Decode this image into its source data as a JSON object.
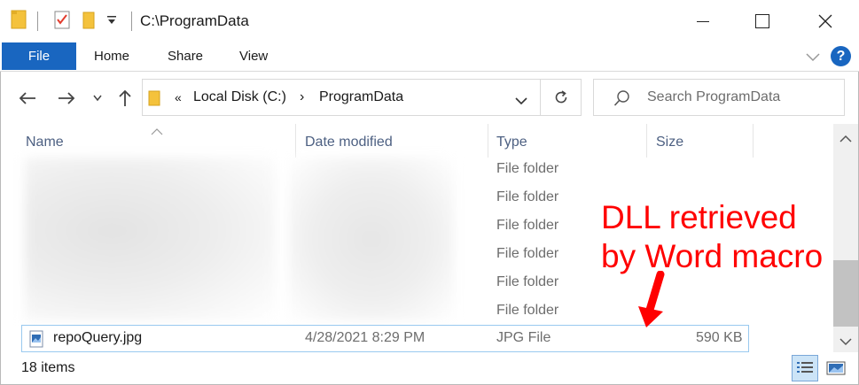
{
  "window": {
    "title": "C:\\ProgramData",
    "minimize_icon": "minimize-icon",
    "maximize_icon": "maximize-icon",
    "close_icon": "close-icon"
  },
  "ribbon": {
    "tabs": [
      "File",
      "Home",
      "Share",
      "View"
    ],
    "help_label": "?"
  },
  "address": {
    "overflow": "«",
    "crumbs": [
      "Local Disk (C:)",
      "ProgramData"
    ],
    "separator": "›"
  },
  "search": {
    "placeholder": "Search ProgramData"
  },
  "columns": [
    "Name",
    "Date modified",
    "Type",
    "Size"
  ],
  "rows": [
    {
      "name": "",
      "date": "",
      "type": "File folder",
      "size": ""
    },
    {
      "name": "",
      "date": "",
      "type": "File folder",
      "size": ""
    },
    {
      "name": "",
      "date": "",
      "type": "File folder",
      "size": ""
    },
    {
      "name": "",
      "date": "",
      "type": "File folder",
      "size": ""
    },
    {
      "name": "",
      "date": "",
      "type": "File folder",
      "size": ""
    },
    {
      "name": "",
      "date": "",
      "type": "File folder",
      "size": ""
    }
  ],
  "selected_row": {
    "name": "repoQuery.jpg",
    "date": "4/28/2021 8:29 PM",
    "type": "JPG File",
    "size": "590 KB"
  },
  "status": {
    "items": "18 items"
  },
  "annotation": {
    "line1": "DLL retrieved",
    "line2": "by Word macro",
    "color": "#ff0000"
  },
  "colors": {
    "accent": "#1966c0",
    "header_text": "#4d6082"
  }
}
